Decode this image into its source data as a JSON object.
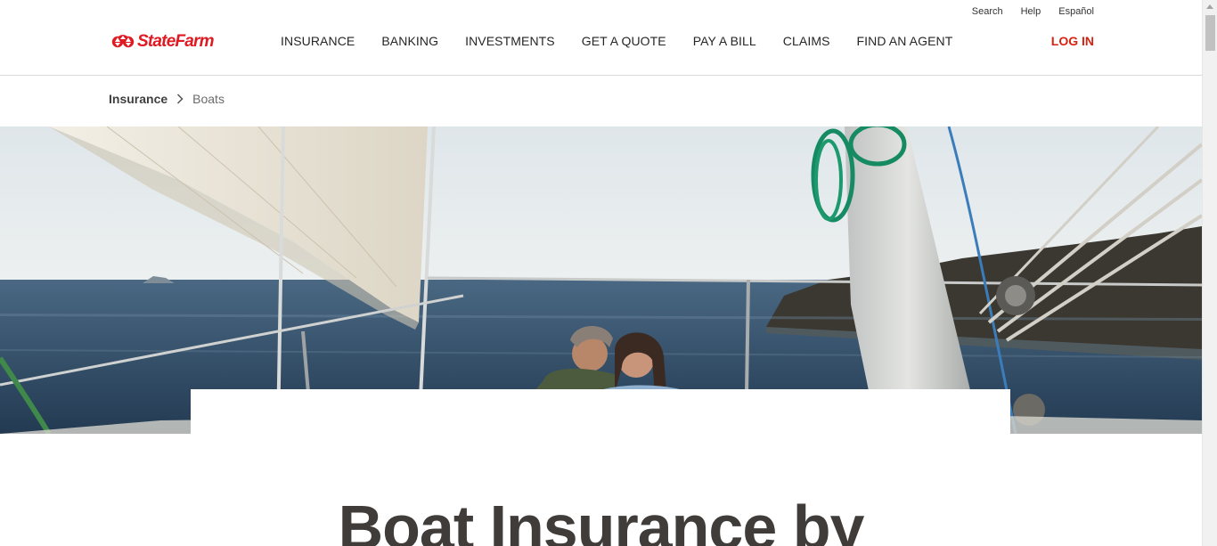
{
  "brand": {
    "name": "StateFarm",
    "color": "#e01a22"
  },
  "utility_nav": [
    {
      "label": "Search"
    },
    {
      "label": "Help"
    },
    {
      "label": "Español"
    }
  ],
  "main_nav": [
    {
      "label": "INSURANCE"
    },
    {
      "label": "BANKING"
    },
    {
      "label": "INVESTMENTS"
    },
    {
      "label": "GET A QUOTE"
    },
    {
      "label": "PAY A BILL"
    },
    {
      "label": "CLAIMS"
    },
    {
      "label": "FIND AN AGENT"
    }
  ],
  "login": {
    "label": "LOG IN",
    "color": "#d62311"
  },
  "breadcrumb": {
    "parent": "Insurance",
    "separator_icon": "chevron-right-icon",
    "current": "Boats"
  },
  "hero": {
    "image_subject": "couple-on-sailboat-photo"
  },
  "headline": "Boat Insurance by",
  "icons": [
    "statefarm-logo-icon",
    "chevron-right-icon",
    "scroll-up-arrow-icon"
  ]
}
